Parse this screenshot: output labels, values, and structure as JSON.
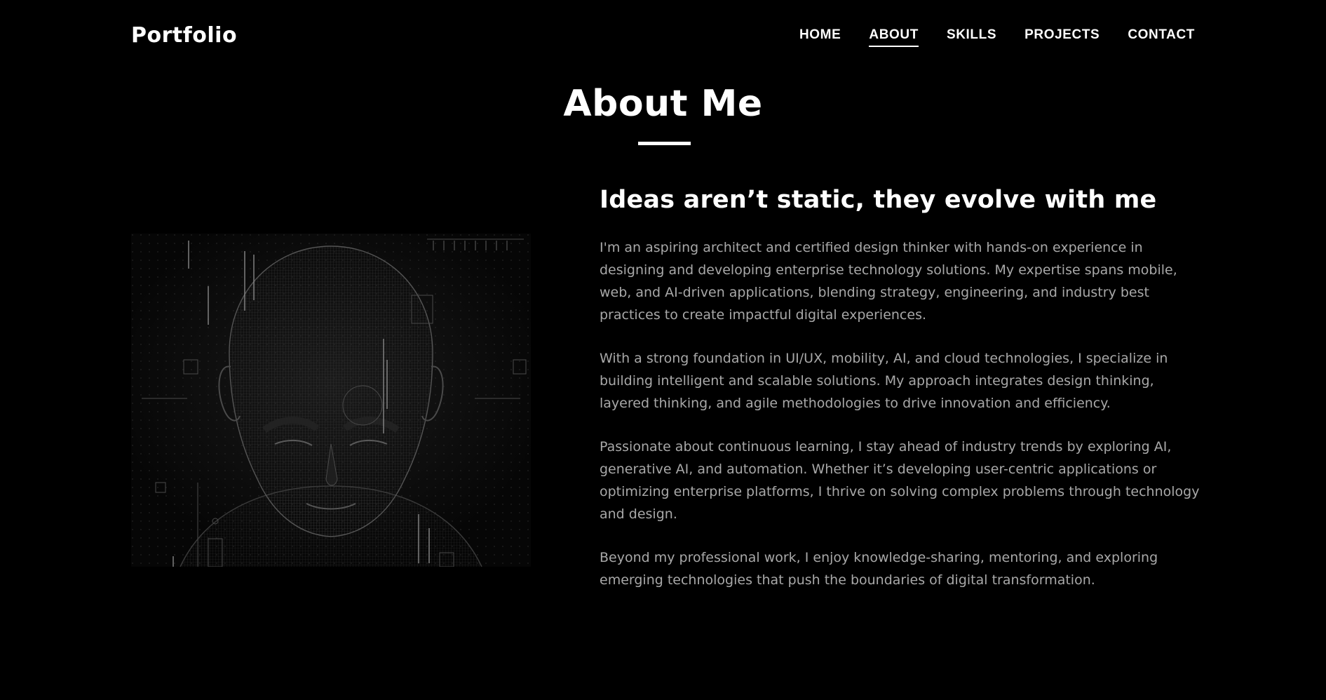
{
  "nav": {
    "logo": "Portfolio",
    "items": [
      {
        "label": "HOME",
        "active": false
      },
      {
        "label": "ABOUT",
        "active": true
      },
      {
        "label": "SKILLS",
        "active": false
      },
      {
        "label": "PROJECTS",
        "active": false
      },
      {
        "label": "CONTACT",
        "active": false
      }
    ]
  },
  "about": {
    "title": "About Me",
    "heading": "Ideas aren’t static, they evolve with me",
    "paragraphs": [
      "I'm an aspiring architect and certified design thinker with hands-on experience in designing and developing enterprise technology solutions. My expertise spans mobile, web, and AI-driven applications, blending strategy, engineering, and industry best practices to create impactful digital experiences.",
      "With a strong foundation in UI/UX, mobility, AI, and cloud technologies, I specialize in building intelligent and scalable solutions. My approach integrates design thinking, layered thinking, and agile methodologies to drive innovation and efficiency.",
      "Passionate about continuous learning, I stay ahead of industry trends by exploring AI, generative AI, and automation. Whether it’s developing user-centric applications or optimizing enterprise platforms, I thrive on solving complex problems through technology and design.",
      "Beyond my professional work, I enjoy knowledge-sharing, mentoring, and exploring emerging technologies that push the boundaries of digital transformation."
    ]
  },
  "colors": {
    "background": "#000000",
    "text_primary": "#ffffff",
    "text_secondary": "#a8a8a8"
  }
}
